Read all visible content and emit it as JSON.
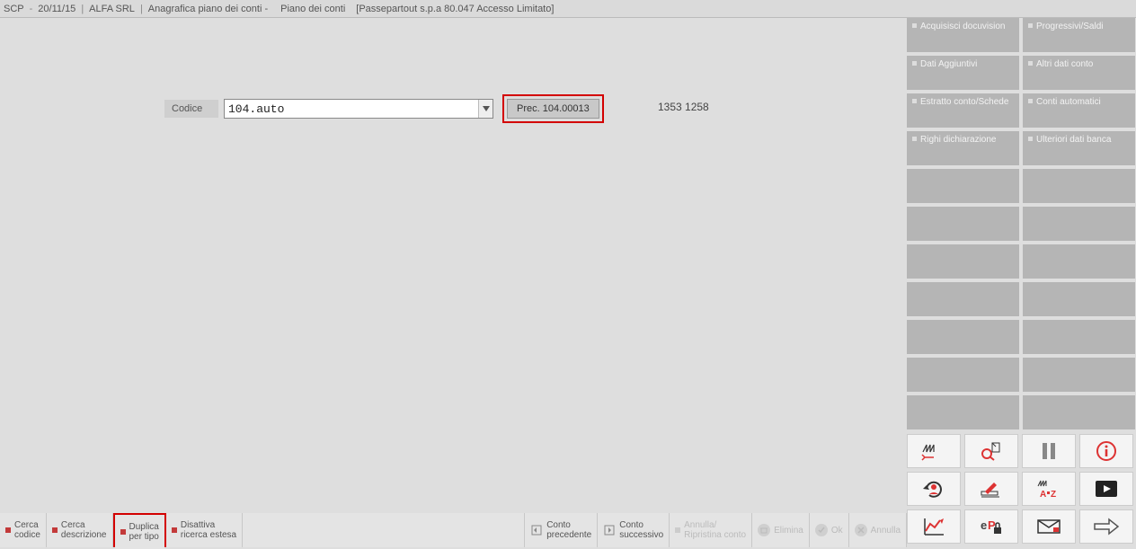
{
  "titlebar": {
    "app": "SCP",
    "date": "20/11/15",
    "company": "ALFA SRL",
    "section": "Anagrafica piano dei conti -",
    "page": "Piano dei conti",
    "access": "[Passepartout s.p.a 80.047 Accesso Limitato]"
  },
  "form": {
    "codice_label": "Codice",
    "codice_value": "104.auto",
    "prec_label": "Prec. 104.00013",
    "status": "1353 1258"
  },
  "side_buttons": [
    [
      "Acquisisci docuvision",
      "Progressivi/Saldi"
    ],
    [
      "Dati Aggiuntivi",
      "Altri dati conto"
    ],
    [
      "Estratto conto/Schede",
      "Conti automatici"
    ],
    [
      "Righi dichiarazione",
      "Ulteriori dati banca"
    ],
    [
      "",
      ""
    ],
    [
      "",
      ""
    ],
    [
      "",
      ""
    ],
    [
      "",
      ""
    ],
    [
      "",
      ""
    ],
    [
      "",
      ""
    ],
    [
      "",
      ""
    ]
  ],
  "side_icons": {
    "row1": [
      "factory-back-icon",
      "search-doc-icon",
      "pause-icon",
      "info-icon"
    ],
    "row2": [
      "refresh-user-icon",
      "edit-pen-icon",
      "factory-az-icon",
      "play-video-icon"
    ],
    "row3": [
      "chart-line-icon",
      "ep-lock-icon",
      "mail-icon",
      "arrow-right-icon"
    ]
  },
  "bottom": {
    "cerca_codice": "Cerca\ncodice",
    "cerca_descrizione": "Cerca\ndescrizione",
    "duplica_per_tipo": "Duplica\nper tipo",
    "disattiva_ricerca": "Disattiva\nricerca estesa",
    "conto_precedente": "Conto\nprecedente",
    "conto_successivo": "Conto\nsuccessivo",
    "annulla_ripristina": "Annulla/\nRipristina conto",
    "elimina": "Elimina",
    "ok": "Ok",
    "annulla": "Annulla"
  }
}
